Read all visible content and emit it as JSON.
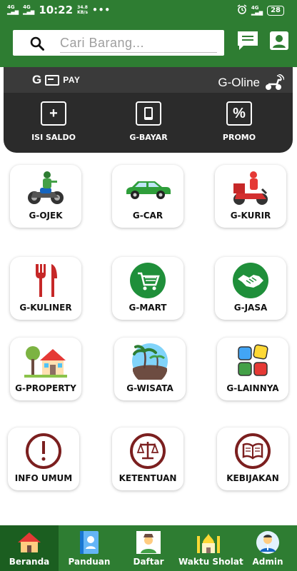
{
  "status_bar": {
    "signal_1": "4G",
    "signal_2": "4G",
    "time": "10:22",
    "speed_value": "34.8",
    "speed_unit": "KB/s",
    "dots": "•••",
    "network": "4G",
    "battery": "28"
  },
  "search": {
    "placeholder": "Cari Barang..."
  },
  "pay": {
    "brand_letter": "G",
    "brand_label": "PAY",
    "online_label": "G-Oline",
    "actions": [
      {
        "label": "ISI SALDO",
        "glyph": "+",
        "icon": "plus-icon"
      },
      {
        "label": "G-BAYAR",
        "glyph": "",
        "icon": "phone-icon"
      },
      {
        "label": "PROMO",
        "glyph": "%",
        "icon": "percent-icon"
      }
    ]
  },
  "services": [
    {
      "label": "G-OJEK",
      "icon": "motorbike-driver-icon"
    },
    {
      "label": "G-CAR",
      "icon": "car-icon"
    },
    {
      "label": "G-KURIR",
      "icon": "courier-scooter-icon"
    },
    {
      "label": "G-KULINER",
      "icon": "fork-knife-icon"
    },
    {
      "label": "G-MART",
      "icon": "shopping-cart-icon"
    },
    {
      "label": "G-JASA",
      "icon": "handshake-icon"
    },
    {
      "label": "G-PROPERTY",
      "icon": "house-icon"
    },
    {
      "label": "G-WISATA",
      "icon": "beach-icon"
    },
    {
      "label": "G-LAINNYA",
      "icon": "blocks-icon"
    },
    {
      "label": "INFO UMUM",
      "icon": "exclamation-icon"
    },
    {
      "label": "KETENTUAN",
      "icon": "scales-icon"
    },
    {
      "label": "KEBIJAKAN",
      "icon": "book-icon"
    }
  ],
  "bottom_nav": [
    {
      "label": "Beranda",
      "icon": "home-icon",
      "active": true
    },
    {
      "label": "Panduan",
      "icon": "guide-book-icon",
      "active": false
    },
    {
      "label": "Daftar",
      "icon": "register-person-icon",
      "active": false
    },
    {
      "label": "Waktu Sholat",
      "icon": "mosque-icon",
      "active": false
    },
    {
      "label": "Admin",
      "icon": "admin-person-icon",
      "active": false
    }
  ],
  "colors": {
    "primary_green": "#2e7d32",
    "active_nav": "#1b5e20",
    "pay_card": "#2b2b2b",
    "info_maroon": "#7b1f1f"
  }
}
